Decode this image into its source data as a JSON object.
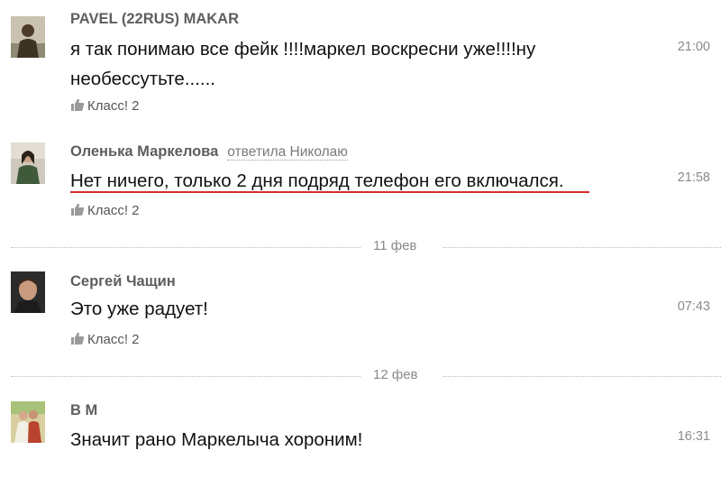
{
  "comments": [
    {
      "author": "PAVEL (22RUS) MAKAR",
      "reply_to": "",
      "text_lines": [
        "я так понимаю все фейк !!!!маркел воскресни уже!!!!ну",
        "необессутьте......"
      ],
      "time": "21:00",
      "like_label": "Класс! 2"
    },
    {
      "author": "Оленька Маркелова",
      "reply_to": "ответила Николаю",
      "text_lines": [
        "Нет ничего, только 2 дня подряд телефон его включался."
      ],
      "time": "21:58",
      "like_label": "Класс! 2"
    },
    {
      "author": "Сергей Чащин",
      "reply_to": "",
      "text_lines": [
        "Это уже радует!"
      ],
      "time": "07:43",
      "like_label": "Класс! 2"
    },
    {
      "author": "В М",
      "reply_to": "",
      "text_lines": [
        "Значит рано Маркелыча хороним!"
      ],
      "time": "16:31",
      "like_label": ""
    }
  ],
  "date_separators": [
    "11 фев",
    "12 фев"
  ],
  "colors": {
    "highlight_underline": "#d62b2b",
    "author": "#5e5e5e",
    "meta": "#8a8a8a"
  },
  "icons": {
    "like": "thumbs-up-icon"
  }
}
